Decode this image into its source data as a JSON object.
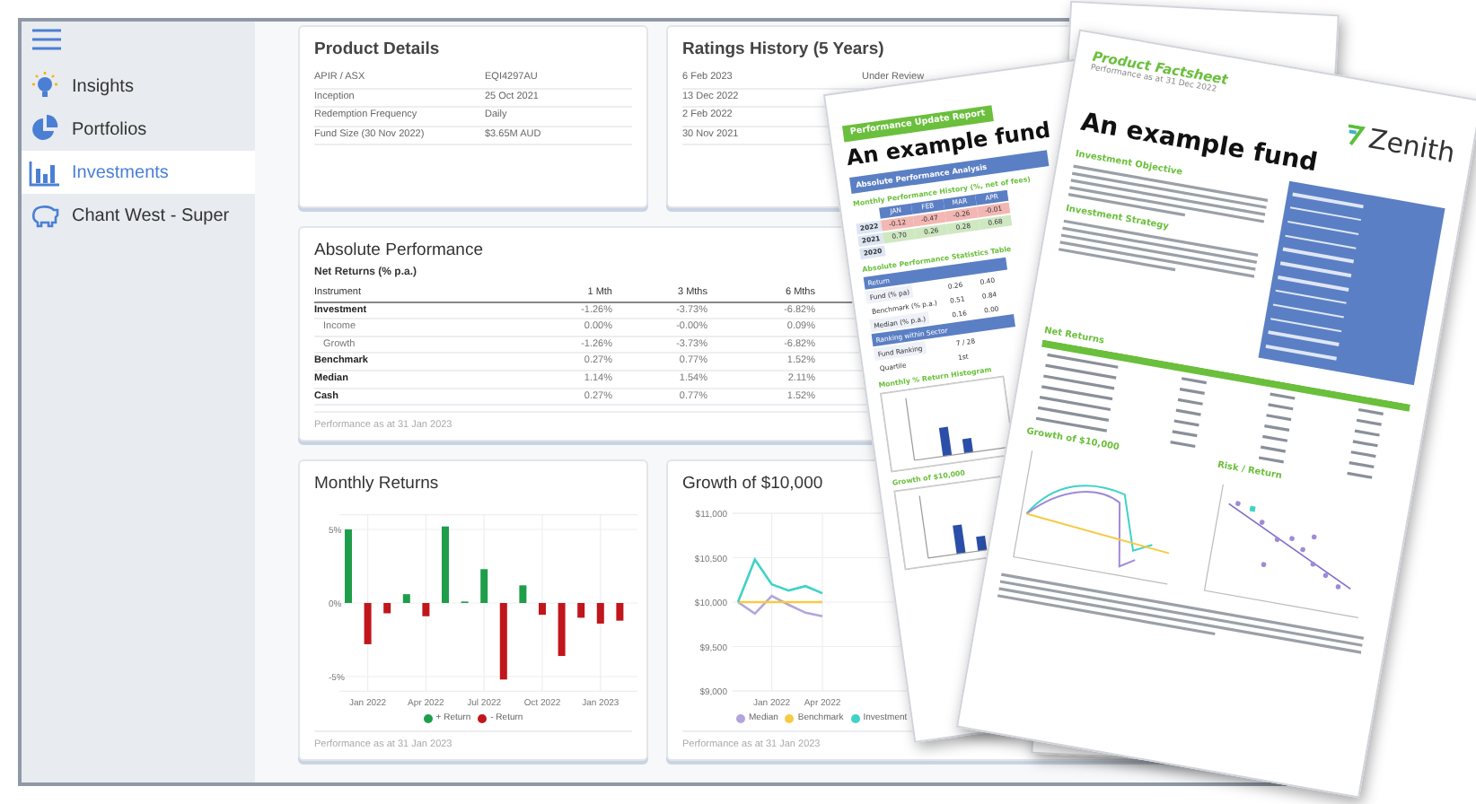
{
  "sidebar": {
    "items": [
      {
        "label": "Insights",
        "kind": "bulb",
        "selected": false
      },
      {
        "label": "Portfolios",
        "kind": "pie",
        "selected": false
      },
      {
        "label": "Investments",
        "kind": "bars",
        "selected": true
      },
      {
        "label": "Chant West - Super",
        "kind": "piggy",
        "selected": false
      }
    ]
  },
  "product_details": {
    "title": "Product Details",
    "rows": [
      {
        "label": "APIR / ASX",
        "value": "EQI4297AU"
      },
      {
        "label": "Inception",
        "value": "25 Oct 2021"
      },
      {
        "label": "Redemption Frequency",
        "value": "Daily"
      },
      {
        "label": "Fund Size (30 Nov 2022)",
        "value": "$3.65M AUD"
      }
    ]
  },
  "ratings_history": {
    "title": "Ratings History (5 Years)",
    "rows": [
      {
        "date": "6 Feb 2023",
        "rating": "Under Review"
      },
      {
        "date": "13 Dec 2022"
      },
      {
        "date": "2 Feb 2022"
      },
      {
        "date": "30 Nov 2021"
      }
    ]
  },
  "absolute_performance": {
    "title": "Absolute Performance",
    "subtitle": "Net Returns (% p.a.)",
    "columns": [
      "Instrument",
      "1 Mth",
      "3 Mths",
      "6 Mths"
    ],
    "rows": [
      {
        "kind": "main",
        "cells": [
          "Investment",
          "-1.26%",
          "-3.73%",
          "-6.82%"
        ]
      },
      {
        "kind": "sub",
        "cells": [
          "Income",
          "0.00%",
          "-0.00%",
          "0.09%"
        ]
      },
      {
        "kind": "sub",
        "cells": [
          "Growth",
          "-1.26%",
          "-3.73%",
          "-6.82%"
        ]
      },
      {
        "kind": "main",
        "cells": [
          "Benchmark",
          "0.27%",
          "0.77%",
          "1.52%"
        ]
      },
      {
        "kind": "main",
        "cells": [
          "Median",
          "1.14%",
          "1.54%",
          "2.11%"
        ]
      },
      {
        "kind": "main",
        "cells": [
          "Cash",
          "0.27%",
          "0.77%",
          "1.52%"
        ]
      }
    ],
    "footer": "Performance as at 31 Jan 2023"
  },
  "monthly_returns": {
    "title": "Monthly Returns",
    "footer": "Performance as at 31 Jan 2023",
    "chart_data": {
      "type": "bar",
      "stacked": true,
      "grid": true,
      "legend": "bottom",
      "categories": [
        null,
        "Jan 2022",
        null,
        null,
        "Apr 2022",
        null,
        null,
        "Jul 2022",
        null,
        null,
        "Oct 2022",
        null,
        null,
        "Jan 2023",
        null
      ],
      "ylim": [
        -6,
        6
      ],
      "yticks": [
        {
          "value": 5,
          "label": "5%"
        },
        {
          "value": 0,
          "label": "0%"
        },
        {
          "value": -5,
          "label": "-5%"
        }
      ],
      "series": [
        {
          "name": "+ Return",
          "color": "#1e9e4a",
          "values": [
            5.0,
            null,
            null,
            0.6,
            null,
            5.2,
            0.1,
            2.3,
            null,
            1.2,
            null,
            null,
            null,
            null,
            null
          ]
        },
        {
          "name": "- Return",
          "color": "#c0161c",
          "values": [
            null,
            -2.8,
            -0.7,
            null,
            -0.9,
            null,
            null,
            null,
            -5.2,
            null,
            -0.8,
            -3.6,
            -1.0,
            -1.4,
            -1.2
          ]
        }
      ]
    }
  },
  "growth": {
    "title": "Growth of $10,000",
    "footer": "Performance as at 31 Jan 2023",
    "chart_data": {
      "type": "line",
      "grid": true,
      "legend": "bottom",
      "categories": [
        null,
        null,
        "Jan 2022",
        null,
        null,
        "Apr 2022"
      ],
      "ylim": [
        9000,
        11000
      ],
      "yticks": [
        {
          "value": 11000,
          "label": "$11,000"
        },
        {
          "value": 10500,
          "label": "$10,500"
        },
        {
          "value": 10000,
          "label": "$10,000"
        },
        {
          "value": 9500,
          "label": "$9,500"
        },
        {
          "value": 9000,
          "label": "$9,000"
        }
      ],
      "series": [
        {
          "name": "Median",
          "color": "#b3a5dc",
          "values": [
            10000,
            9870,
            10070,
            9970,
            9880,
            9840
          ]
        },
        {
          "name": "Benchmark",
          "color": "#f5cb45",
          "values": [
            10000,
            10000,
            10000,
            10000,
            10000,
            10000
          ]
        },
        {
          "name": "Investment",
          "color": "#3fd2c7",
          "values": [
            10000,
            10480,
            10200,
            10130,
            10180,
            10100
          ]
        }
      ]
    }
  },
  "documents": [
    {
      "kind": "report",
      "badge": "Performance Update Report",
      "title": "An example fund",
      "section": "Absolute Performance Analysis",
      "history": {
        "heading": "Monthly Performance History (%, net of fees)",
        "months": [
          "JAN",
          "FEB",
          "MAR",
          "APR"
        ],
        "rows": [
          {
            "year": "2022",
            "values": [
              "-0.12",
              "-0.47",
              "-0.26",
              "-0.01"
            ]
          },
          {
            "year": "2021",
            "values": [
              "0.70",
              "0.26",
              "0.28",
              "0.68"
            ]
          },
          {
            "year": "2020"
          }
        ]
      },
      "stats": {
        "heading": "Absolute Performance Statistics Table",
        "rows": [
          {
            "kind": "header",
            "label": "Return"
          },
          {
            "kind": "row",
            "label": "Fund (% pa)",
            "values": [
              "0.26",
              "0.40"
            ]
          },
          {
            "kind": "row",
            "label": "Benchmark (% p.a.)",
            "values": [
              "0.51",
              "0.84"
            ]
          },
          {
            "kind": "row",
            "label": "Median (% p.a.)",
            "values": [
              "0.16",
              "0.00"
            ]
          },
          {
            "kind": "header",
            "label": "Ranking within Sector"
          },
          {
            "kind": "row",
            "label": "Fund Ranking",
            "values": [
              "7 / 28"
            ]
          },
          {
            "kind": "row",
            "label": "Quartile",
            "values": [
              "1st"
            ]
          }
        ]
      },
      "charts": [
        "Monthly % Return Histogram",
        "Growth of $10,000"
      ]
    },
    {
      "kind": "factsheet",
      "heading": "Product Factsheet",
      "date": "Performance as at 31 Dec 2022",
      "logo": "Zenith",
      "title": "An example fund",
      "sections": [
        "Investment Objective",
        "Investment Strategy"
      ],
      "returns_heading": "Net Returns",
      "charts": [
        "Growth of $10,000",
        "Risk / Return"
      ]
    }
  ]
}
